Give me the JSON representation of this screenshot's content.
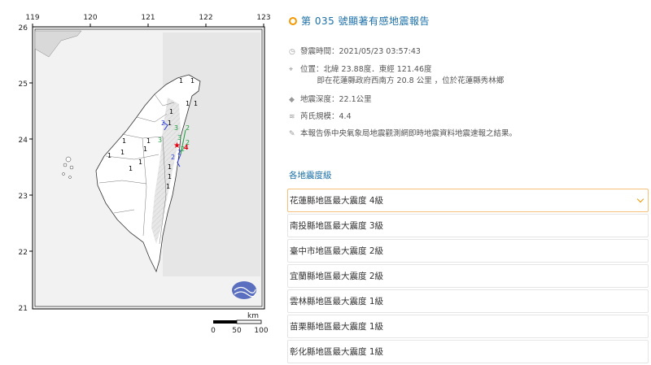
{
  "map": {
    "lon_ticks": [
      "119",
      "120",
      "121",
      "122",
      "123"
    ],
    "lat_ticks": [
      "26",
      "25",
      "24",
      "23",
      "22",
      "21"
    ],
    "scale_unit": "km",
    "scale_ticks": [
      "0",
      "50",
      "100"
    ],
    "epicenter_icon": "red-star",
    "intensity_labels": [
      "1",
      "1",
      "1",
      "1",
      "1",
      "2",
      "1",
      "2",
      "3",
      "3",
      "3",
      "1",
      "2",
      "1",
      "1",
      "2",
      "1",
      "4",
      "1",
      "2",
      "2",
      "1",
      "1",
      "1",
      "1",
      "1"
    ]
  },
  "report": {
    "title": "第 035 號顯著有感地震報告",
    "info": [
      {
        "icon": "clock-icon",
        "label": "發震時間：",
        "value": "2021/05/23 03:57:43"
      },
      {
        "icon": "location-icon",
        "label": "位置：",
        "value": "北緯 23.88度．東經 121.46度",
        "sub": "即在花蓮縣政府西南方 20.8 公里 ，位於花蓮縣秀林鄉"
      },
      {
        "icon": "depth-icon",
        "label": "地震深度：",
        "value": "22.1公里"
      },
      {
        "icon": "magnitude-icon",
        "label": "芮氏規模：",
        "value": "4.4"
      },
      {
        "icon": "pencil-icon",
        "label": "",
        "value": "本報告係中央氣象局地震觀測網即時地震資料地震速報之結果。"
      }
    ],
    "level_heading": "各地震度級",
    "levels": [
      "花蓮縣地區最大震度 4級",
      "南投縣地區最大震度 3級",
      "臺中市地區最大震度 2級",
      "宜蘭縣地區最大震度 2級",
      "雲林縣地區最大震度 1級",
      "苗栗縣地區最大震度 1級",
      "彰化縣地區最大震度 1級"
    ]
  },
  "colors": {
    "accent": "#f39800",
    "title": "#1a6fa8",
    "epicenter": "#e60012"
  }
}
